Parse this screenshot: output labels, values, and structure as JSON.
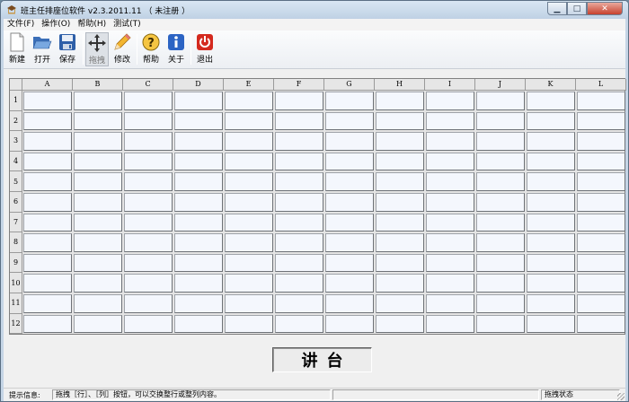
{
  "window": {
    "title": "班主任排座位软件 v2.3.2011.11 （ 未注册 ）",
    "controls": {
      "minimize": "▁",
      "maximize": "□",
      "close": "✕"
    }
  },
  "menu": [
    {
      "label": "文件(F)"
    },
    {
      "label": "操作(O)"
    },
    {
      "label": "帮助(H)"
    },
    {
      "label": "测试(T)"
    }
  ],
  "toolbar": {
    "new": "新建",
    "open": "打开",
    "save": "保存",
    "drag": "拖拽",
    "edit": "修改",
    "help": "帮助",
    "about": "关于",
    "exit": "退出"
  },
  "grid": {
    "columns": [
      "A",
      "B",
      "C",
      "D",
      "E",
      "F",
      "G",
      "H",
      "I",
      "J",
      "K",
      "L"
    ],
    "rows": [
      "1",
      "2",
      "3",
      "4",
      "5",
      "6",
      "7",
      "8",
      "9",
      "10",
      "11",
      "12"
    ]
  },
  "podium": "讲台",
  "status": {
    "label": "提示信息:",
    "message": "拖拽［行］、［列］按钮，可以交换整行或整列内容。",
    "state": "拖拽状态"
  },
  "colors": {
    "cell_bg": "#f4f7fd",
    "exit_red": "#d42a1f",
    "about_blue": "#2c64c4"
  }
}
